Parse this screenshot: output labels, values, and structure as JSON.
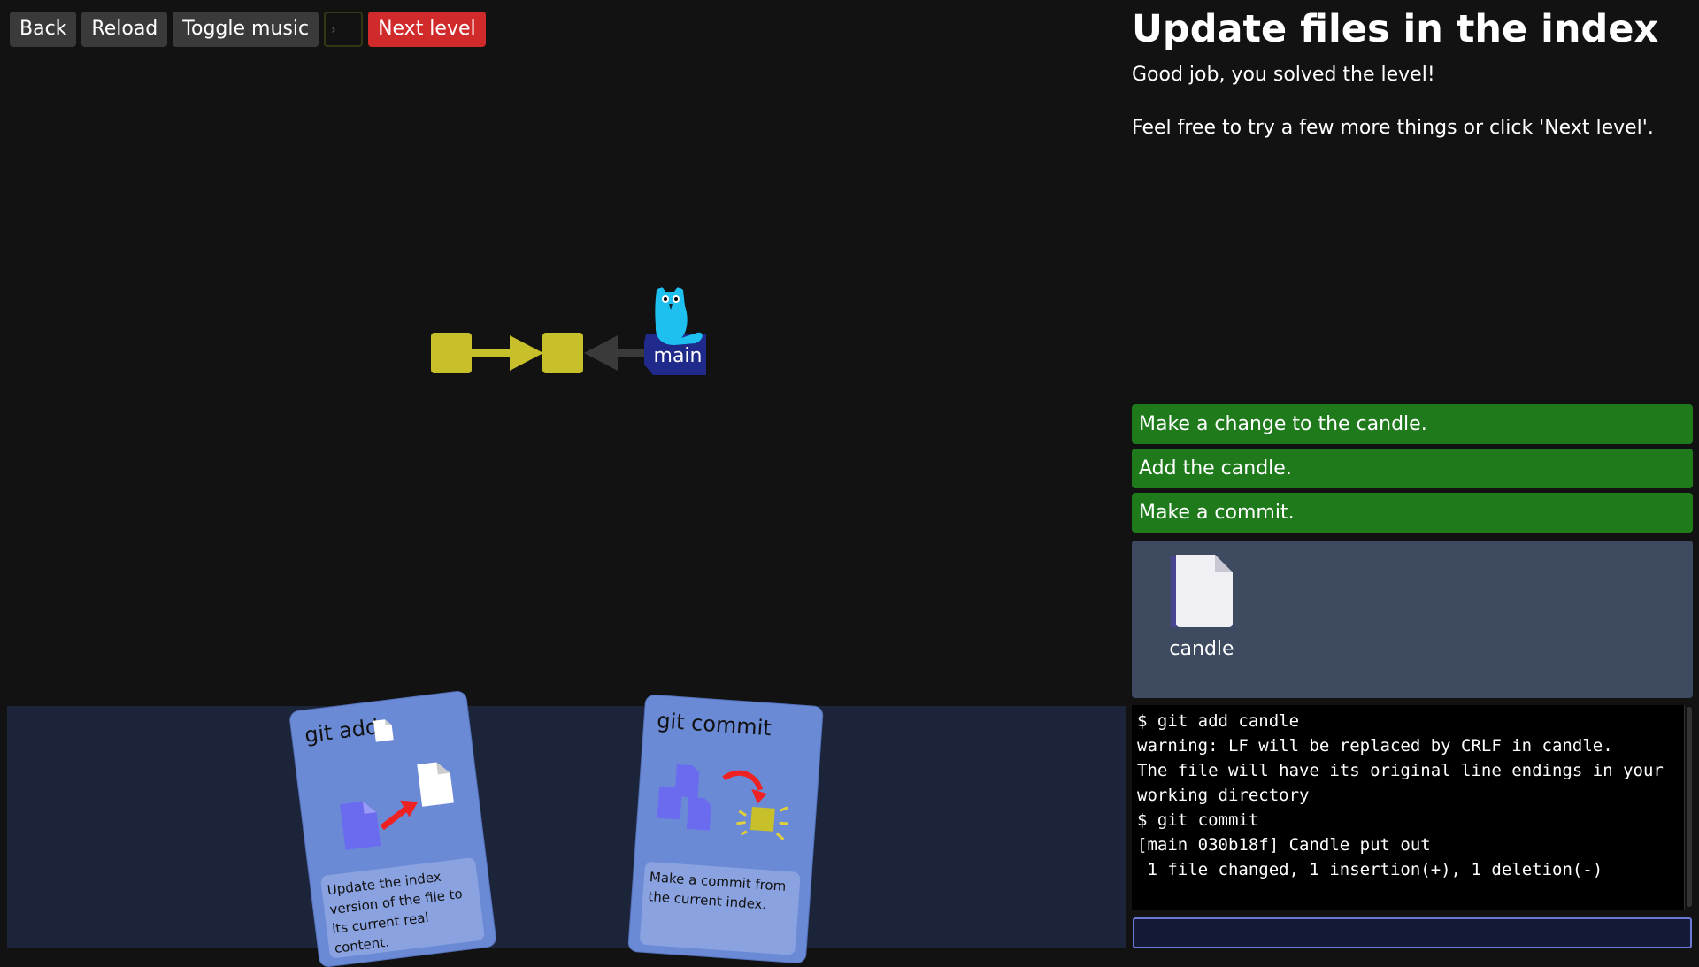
{
  "menu": {
    "back": "Back",
    "reload": "Reload",
    "toggle_music": "Toggle music",
    "terminal_icon": "terminal-icon",
    "next_level": "Next level"
  },
  "graph": {
    "branch_label": "main",
    "head_icon": "owl-icon"
  },
  "level": {
    "title": "Update files in the index",
    "desc1": "Good job, you solved the level!",
    "desc2": "Feel free to try a few more things or click 'Next level'."
  },
  "goals": [
    "Make a change to the candle.",
    "Add the candle.",
    "Make a commit."
  ],
  "files": [
    {
      "name": "candle",
      "icon": "file-icon"
    }
  ],
  "terminal": {
    "lines": [
      "$ git add candle",
      "warning: LF will be replaced by CRLF in candle.",
      "The file will have its original line endings in your working directory",
      "$ git commit",
      "[main 030b18f] Candle put out",
      " 1 file changed, 1 insertion(+), 1 deletion(-)"
    ],
    "input_value": ""
  },
  "cards": [
    {
      "title": "git add",
      "description": "Update the index version of the file to its current real content."
    },
    {
      "title": "git commit",
      "description": "Make a commit from the current index."
    }
  ],
  "colors": {
    "background": "#121212",
    "commit": "#c7c02a",
    "branch": "#1f2a8a",
    "goal_done": "#1f7a1c",
    "next_button": "#d12a2a",
    "card": "#6b8ad6"
  }
}
